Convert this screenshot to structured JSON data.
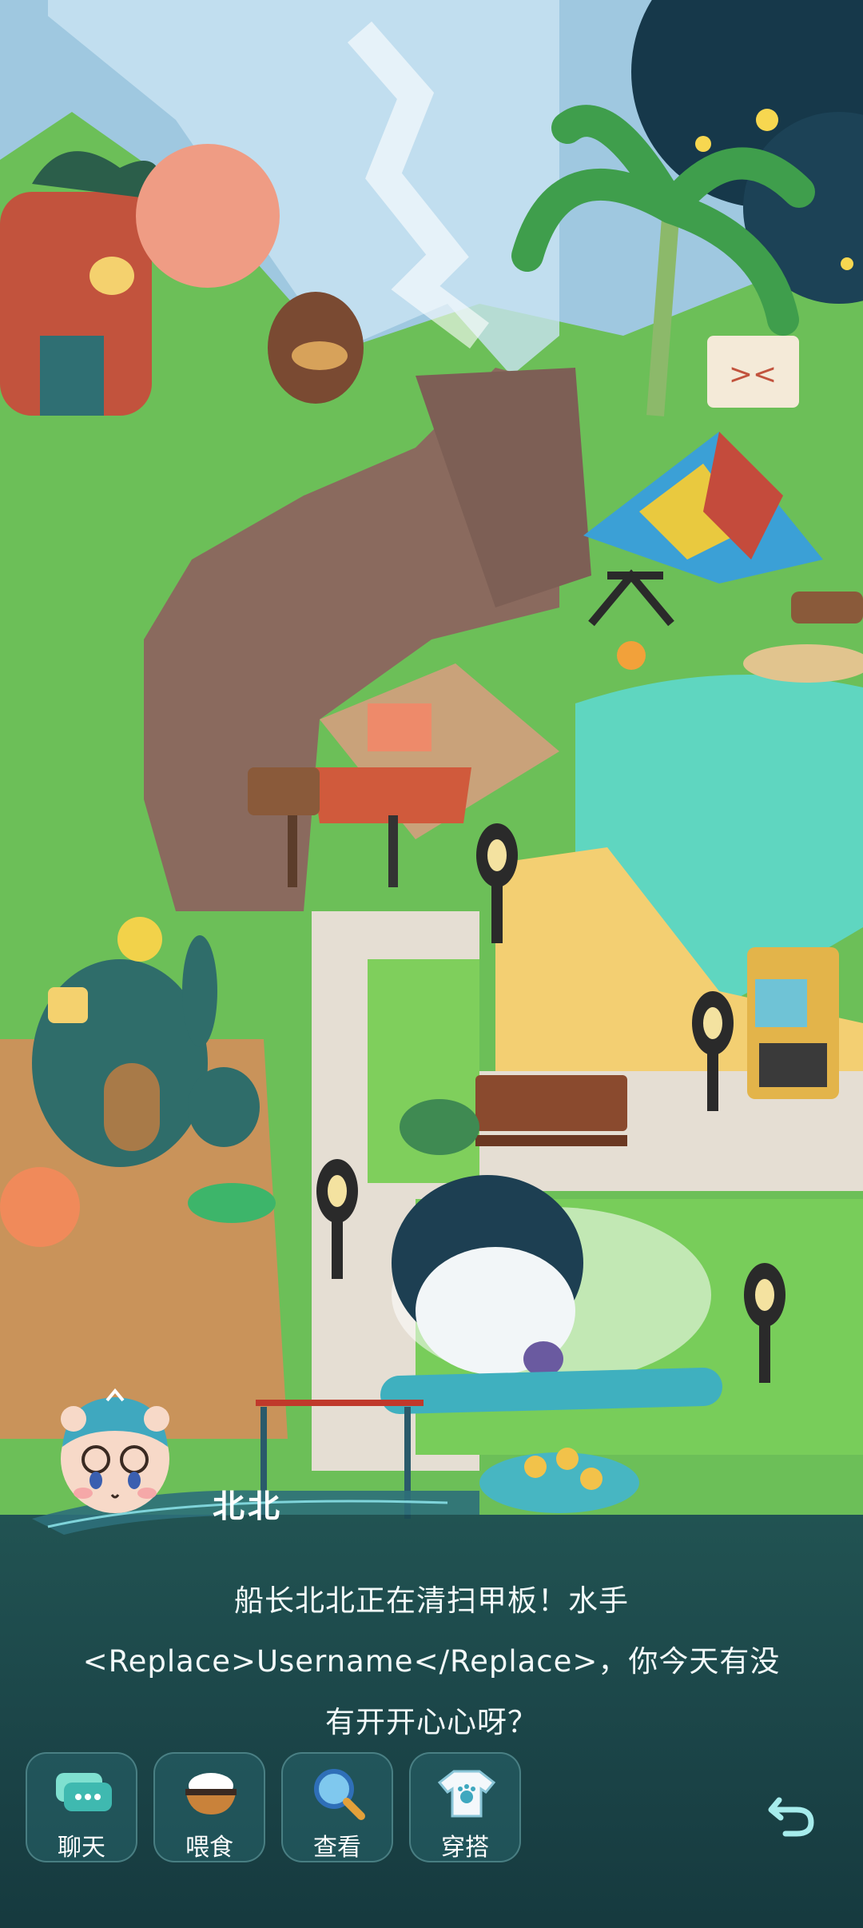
{
  "character": {
    "name": "北北"
  },
  "dialog": {
    "lines": [
      "船长北北正在清扫甲板！水手",
      "<Replace>Username</Replace>，你今天有没",
      "有开开心心呀？"
    ]
  },
  "actions": [
    {
      "label": "聊天",
      "icon": "chat-icon"
    },
    {
      "label": "喂食",
      "icon": "food-bowl-icon"
    },
    {
      "label": "查看",
      "icon": "magnifier-icon"
    },
    {
      "label": "穿搭",
      "icon": "outfit-icon"
    }
  ],
  "back": {
    "icon": "back-arrow-icon"
  },
  "colors": {
    "dialog_bg": "#1b4a52",
    "button_bg": "#28646c",
    "text": "#ffffff",
    "accent": "#8fe0d6"
  }
}
